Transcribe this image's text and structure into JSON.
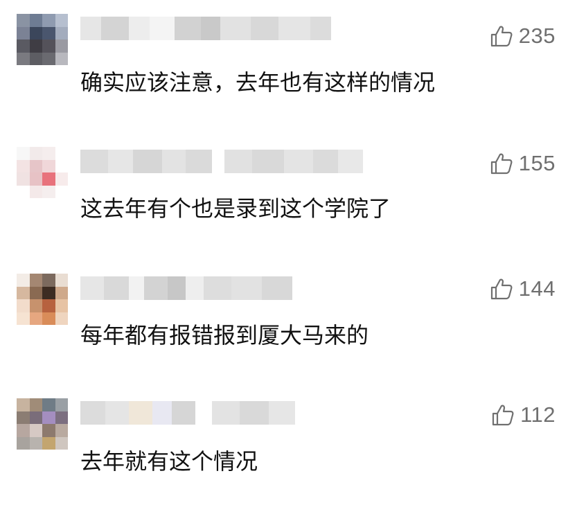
{
  "comments": [
    {
      "likes": "235",
      "text": "确实应该注意，去年也有这样的情况",
      "avatar_colors": [
        "#8a93a3",
        "#6e7c93",
        "#8f9bb0",
        "#b6bfcf",
        "#7b8295",
        "#3b465b",
        "#4a566e",
        "#a3acbd",
        "#5a5a62",
        "#3f3d44",
        "#54525a",
        "#9a9aa2",
        "#7a7a80",
        "#5d5d63",
        "#6a6a70",
        "#b8b8be"
      ],
      "name_blocks": [
        {
          "w": 30,
          "c": "#e6e6e6"
        },
        {
          "w": 40,
          "c": "#d4d4d4"
        },
        {
          "w": 30,
          "c": "#ededed"
        },
        {
          "w": 36,
          "c": "#f4f4f4"
        },
        {
          "w": 38,
          "c": "#d2d2d2"
        },
        {
          "w": 28,
          "c": "#c9c9c9"
        },
        {
          "w": 44,
          "c": "#e2e2e2"
        },
        {
          "w": 40,
          "c": "#d8d8d8"
        },
        {
          "w": 46,
          "c": "#e5e5e5"
        },
        {
          "w": 30,
          "c": "#dcdcdc"
        }
      ]
    },
    {
      "likes": "155",
      "text": "这去年有个也是录到这个学院了",
      "avatar_colors": [
        "#f7f7f7",
        "#f2eaea",
        "#f5eded",
        "#ffffff",
        "#f3e3e3",
        "#e6c5c8",
        "#f0d7d9",
        "#ffffff",
        "#f0e2e2",
        "#e7c2c5",
        "#e8727c",
        "#f7ebeb",
        "#ffffff",
        "#f4e9e9",
        "#f5eeee",
        "#ffffff"
      ],
      "name_blocks": [
        {
          "w": 40,
          "c": "#dcdcdc"
        },
        {
          "w": 36,
          "c": "#e6e6e6"
        },
        {
          "w": 42,
          "c": "#d6d6d6"
        },
        {
          "w": 34,
          "c": "#e3e3e3"
        },
        {
          "w": 38,
          "c": "#dadada"
        },
        {
          "w": 18,
          "c": "#ffffff"
        },
        {
          "w": 40,
          "c": "#e1e1e1"
        },
        {
          "w": 46,
          "c": "#d9d9d9"
        },
        {
          "w": 42,
          "c": "#e4e4e4"
        },
        {
          "w": 36,
          "c": "#dbdbdb"
        },
        {
          "w": 36,
          "c": "#e8e8e8"
        }
      ]
    },
    {
      "likes": "144",
      "text": "每年都有报错报到厦大马来的",
      "avatar_colors": [
        "#f3ece6",
        "#a48772",
        "#7c6a5e",
        "#e9ddd2",
        "#d6b89f",
        "#8a6a52",
        "#3d2c22",
        "#cfa98b",
        "#f2dccb",
        "#c7926d",
        "#b7623f",
        "#e7c3a4",
        "#f6e3d2",
        "#e6a780",
        "#d98c59",
        "#efd5bf"
      ],
      "name_blocks": [
        {
          "w": 34,
          "c": "#e6e6e6"
        },
        {
          "w": 36,
          "c": "#d9d9d9"
        },
        {
          "w": 22,
          "c": "#f2f2f2"
        },
        {
          "w": 34,
          "c": "#d3d3d3"
        },
        {
          "w": 26,
          "c": "#c7c7c7"
        },
        {
          "w": 26,
          "c": "#eeeeee"
        },
        {
          "w": 40,
          "c": "#dddddd"
        },
        {
          "w": 44,
          "c": "#e2e2e2"
        },
        {
          "w": 44,
          "c": "#d8d8d8"
        }
      ]
    },
    {
      "likes": "112",
      "text": "去年就有这个情况",
      "avatar_colors": [
        "#c7b39f",
        "#a08c78",
        "#6f7c86",
        "#9aa0a5",
        "#8b7d73",
        "#7a6d7a",
        "#a48ec0",
        "#7c6f80",
        "#b7a7a0",
        "#d6c9c4",
        "#8d7a6e",
        "#b9aaa0",
        "#a8a39e",
        "#b8b3ae",
        "#c3a56f",
        "#cfc6bf"
      ],
      "name_blocks": [
        {
          "w": 36,
          "c": "#dcdcdc"
        },
        {
          "w": 34,
          "c": "#e5e5e5"
        },
        {
          "w": 34,
          "c": "#f0e7d9"
        },
        {
          "w": 28,
          "c": "#e8e8f2"
        },
        {
          "w": 34,
          "c": "#d6d6d6"
        },
        {
          "w": 24,
          "c": "#ffffff"
        },
        {
          "w": 40,
          "c": "#e3e3e3"
        },
        {
          "w": 42,
          "c": "#d9d9d9"
        },
        {
          "w": 38,
          "c": "#e6e6e6"
        }
      ]
    }
  ]
}
